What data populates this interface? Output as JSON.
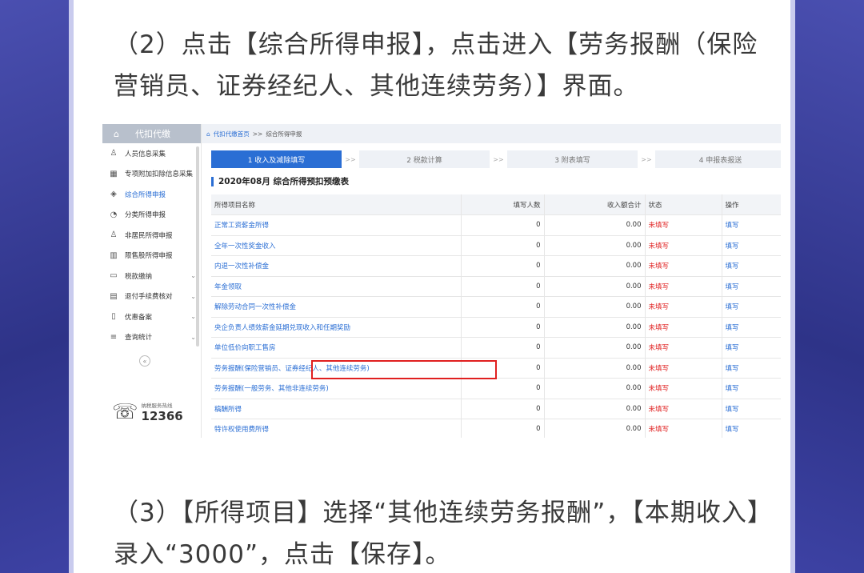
{
  "instructions": {
    "step2": "（2）点击【综合所得申报】，点击进入【劳务报酬（保险营销员、证券经纪人、其他连续劳务）】界面。",
    "step3": "（3）【所得项目】选择“其他连续劳务报酬”，【本期收入】录入“3000”，点击【保存】。"
  },
  "sidebar": {
    "header": "代扣代缴",
    "header_icon": "home-icon",
    "items": [
      {
        "label": "人员信息采集",
        "icon": "user-icon"
      },
      {
        "label": "专项附加扣除信息采集",
        "icon": "grid-icon"
      },
      {
        "label": "综合所得申报",
        "icon": "layers-icon"
      },
      {
        "label": "分类所得申报",
        "icon": "pie-icon"
      },
      {
        "label": "非居民所得申报",
        "icon": "person-icon"
      },
      {
        "label": "限售股所得申报",
        "icon": "bar-chart-icon"
      },
      {
        "label": "税款缴纳",
        "icon": "folder-icon"
      },
      {
        "label": "退付手续费核对",
        "icon": "document-icon"
      },
      {
        "label": "优惠备案",
        "icon": "file-icon"
      },
      {
        "label": "查询统计",
        "icon": "search-list-icon"
      }
    ],
    "hotline_label": "纳税服务热线",
    "hotline_number": "12366"
  },
  "breadcrumb": {
    "home": "代扣代缴首页",
    "sep": ">>",
    "current": "综合所得申报"
  },
  "steps": [
    "1 收入及减除填写",
    "2 税款计算",
    "3 附表填写",
    "4 申报表报送"
  ],
  "step_sep": ">>",
  "form_title": "2020年08月  综合所得预扣预缴表",
  "table": {
    "headers": [
      "所得项目名称",
      "填写人数",
      "收入额合计",
      "状态",
      "操作"
    ],
    "rows": [
      {
        "name": "正常工资薪金所得",
        "count": "0",
        "income": "0.00",
        "status": "未填写",
        "op": "填写"
      },
      {
        "name": "全年一次性奖金收入",
        "count": "0",
        "income": "0.00",
        "status": "未填写",
        "op": "填写"
      },
      {
        "name": "内退一次性补偿金",
        "count": "0",
        "income": "0.00",
        "status": "未填写",
        "op": "填写"
      },
      {
        "name": "年金领取",
        "count": "0",
        "income": "0.00",
        "status": "未填写",
        "op": "填写"
      },
      {
        "name": "解除劳动合同一次性补偿金",
        "count": "0",
        "income": "0.00",
        "status": "未填写",
        "op": "填写"
      },
      {
        "name": "央企负责人绩效薪金延期兑现收入和任期奖励",
        "count": "0",
        "income": "0.00",
        "status": "未填写",
        "op": "填写"
      },
      {
        "name": "单位低价向职工售房",
        "count": "0",
        "income": "0.00",
        "status": "未填写",
        "op": "填写"
      },
      {
        "name": "劳务报酬(保险营销员、证券经纪人、其他连续劳务)",
        "count": "0",
        "income": "0.00",
        "status": "未填写",
        "op": "填写"
      },
      {
        "name": "劳务报酬(一般劳务、其他非连续劳务)",
        "count": "0",
        "income": "0.00",
        "status": "未填写",
        "op": "填写"
      },
      {
        "name": "稿酬所得",
        "count": "0",
        "income": "0.00",
        "status": "未填写",
        "op": "填写"
      },
      {
        "name": "特许权使用费所得",
        "count": "0",
        "income": "0.00",
        "status": "未填写",
        "op": "填写"
      }
    ]
  },
  "colors": {
    "accent": "#2a6ed4",
    "status_red": "#e02020",
    "background": "#3a3f9e"
  }
}
